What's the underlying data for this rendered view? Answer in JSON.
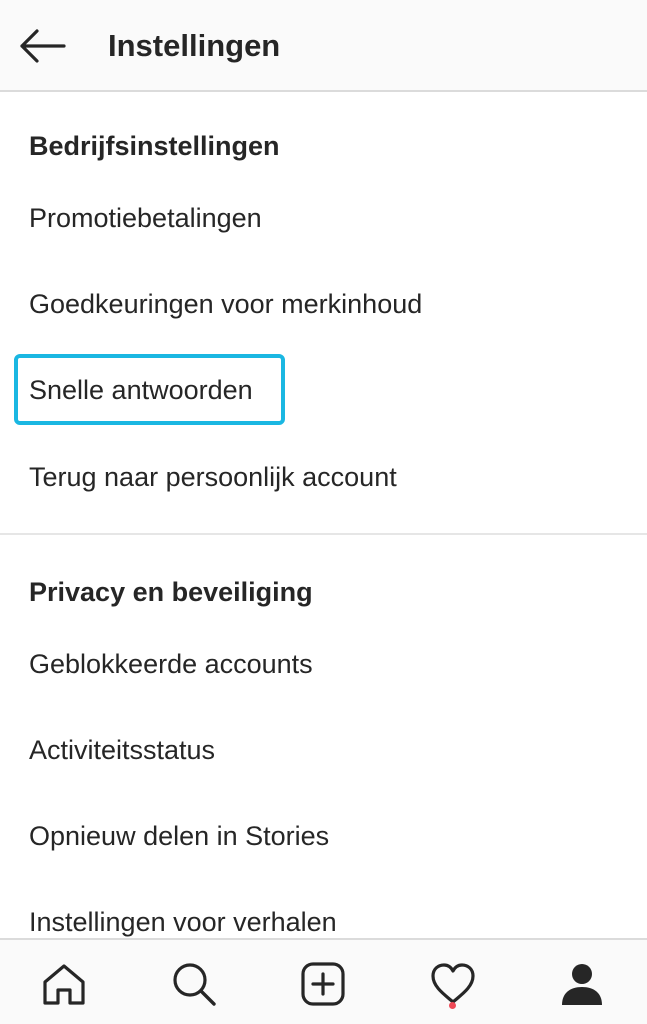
{
  "header": {
    "title": "Instellingen",
    "back_icon": "arrow-left-icon"
  },
  "sections": [
    {
      "heading": "Bedrijfsinstellingen",
      "items": [
        {
          "label": "Promotiebetalingen"
        },
        {
          "label": "Goedkeuringen voor merkinhoud"
        },
        {
          "label": "Snelle antwoorden",
          "highlighted": true
        },
        {
          "label": "Terug naar persoonlijk account"
        }
      ]
    },
    {
      "heading": "Privacy en beveiliging",
      "items": [
        {
          "label": "Geblokkeerde accounts"
        },
        {
          "label": "Activiteitsstatus"
        },
        {
          "label": "Opnieuw delen in Stories"
        },
        {
          "label": "Instellingen voor verhalen"
        }
      ]
    }
  ],
  "tab_bar": {
    "tabs": [
      {
        "icon": "home-icon"
      },
      {
        "icon": "search-icon"
      },
      {
        "icon": "add-post-icon"
      },
      {
        "icon": "heart-icon",
        "has_notification": true
      },
      {
        "icon": "profile-icon",
        "active": true
      }
    ]
  },
  "colors": {
    "highlight_border": "#1ab7e2",
    "notification_dot": "#ed4956",
    "text": "#262626"
  }
}
